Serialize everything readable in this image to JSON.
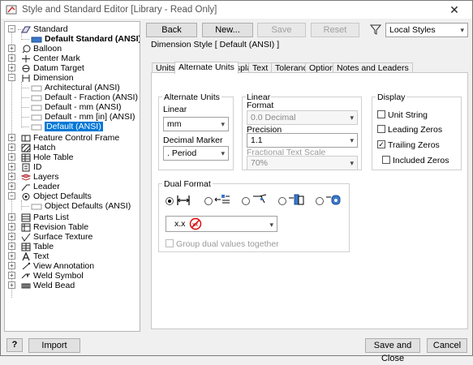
{
  "window": {
    "title": "Style and Standard Editor [Library - Read Only]",
    "close_glyph": "✕"
  },
  "tree": {
    "standard": "Standard",
    "default_standard": "Default Standard (ANSI)",
    "balloon": "Balloon",
    "center_mark": "Center Mark",
    "datum_target": "Datum Target",
    "dimension": "Dimension",
    "dim_children": [
      "Architectural (ANSI)",
      "Default - Fraction (ANSI)",
      "Default - mm (ANSI)",
      "Default - mm [in] (ANSI)",
      "Default (ANSI)"
    ],
    "feature_control_frame": "Feature Control Frame",
    "hatch": "Hatch",
    "hole_table": "Hole Table",
    "id": "ID",
    "layers": "Layers",
    "leader": "Leader",
    "object_defaults": "Object Defaults",
    "object_defaults_child": "Object Defaults (ANSI)",
    "parts_list": "Parts List",
    "revision_table": "Revision Table",
    "surface_texture": "Surface Texture",
    "table": "Table",
    "text": "Text",
    "view_annotation": "View Annotation",
    "weld_symbol": "Weld Symbol",
    "weld_bead": "Weld Bead"
  },
  "toolbar": {
    "back": "Back",
    "new": "New...",
    "save": "Save",
    "reset": "Reset",
    "filter_value": "Local Styles"
  },
  "style_header": "Dimension Style [ Default (ANSI) ]",
  "tabs": [
    "Units",
    "Alternate Units",
    "Display",
    "Text",
    "Tolerance",
    "Options",
    "Notes and Leaders"
  ],
  "alt_units": {
    "group_label": "Alternate Units",
    "linear_label": "Linear",
    "linear_value": "mm",
    "decimal_marker_label": "Decimal Marker",
    "decimal_marker_value": ". Period",
    "linear_format_label": "Linear\nFormat",
    "linear_format_line1": "Linear",
    "linear_format_line2": "Format",
    "format_value": "0.0 Decimal",
    "precision_label": "Precision",
    "precision_value": "1.1",
    "fractional_scale_label": "Fractional Text Scale",
    "fractional_scale_value": "70%"
  },
  "display": {
    "group_label": "Display",
    "unit_string": "Unit String",
    "leading_zeros": "Leading Zeros",
    "trailing_zeros": "Trailing Zeros",
    "included_zeros": "Included Zeros",
    "unit_string_checked": false,
    "leading_zeros_checked": false,
    "trailing_zeros_checked": true,
    "included_zeros_checked": false
  },
  "dual_format": {
    "group_label": "Dual Format",
    "format_value": "x.x",
    "group_dual": "Group dual values together"
  },
  "bottom": {
    "help_glyph": "?",
    "import": "Import",
    "save_close": "Save and Close",
    "cancel": "Cancel"
  },
  "colors": {
    "accent": "#0078d7",
    "disabled_text": "#a0a0a0",
    "no_symbol": "#e00000"
  }
}
